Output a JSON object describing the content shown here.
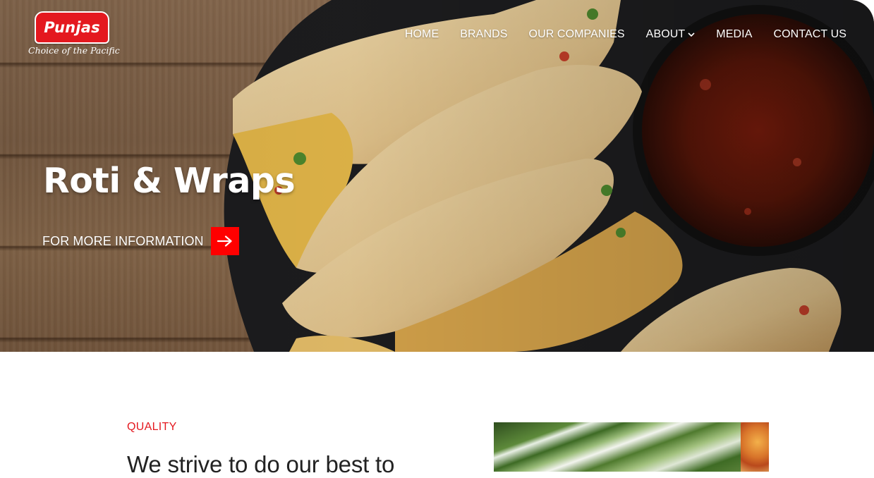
{
  "brand": {
    "logo_word": "Punjas",
    "logo_tagline": "Choice of the Pacific",
    "accent_color": "#e4181f"
  },
  "nav": {
    "items": [
      {
        "label": "HOME"
      },
      {
        "label": "BRANDS"
      },
      {
        "label": "OUR COMPANIES"
      },
      {
        "label": "ABOUT",
        "icon": "chevron-down-icon"
      },
      {
        "label": "MEDIA"
      },
      {
        "label": "CONTACT US"
      }
    ]
  },
  "hero": {
    "title": "Roti & Wraps",
    "cta_label": "FOR MORE INFORMATION",
    "cta_icon": "arrow-right-icon",
    "cta_color": "#ff0000"
  },
  "section": {
    "eyebrow": "QUALITY",
    "lead": "We strive to do our best to"
  }
}
